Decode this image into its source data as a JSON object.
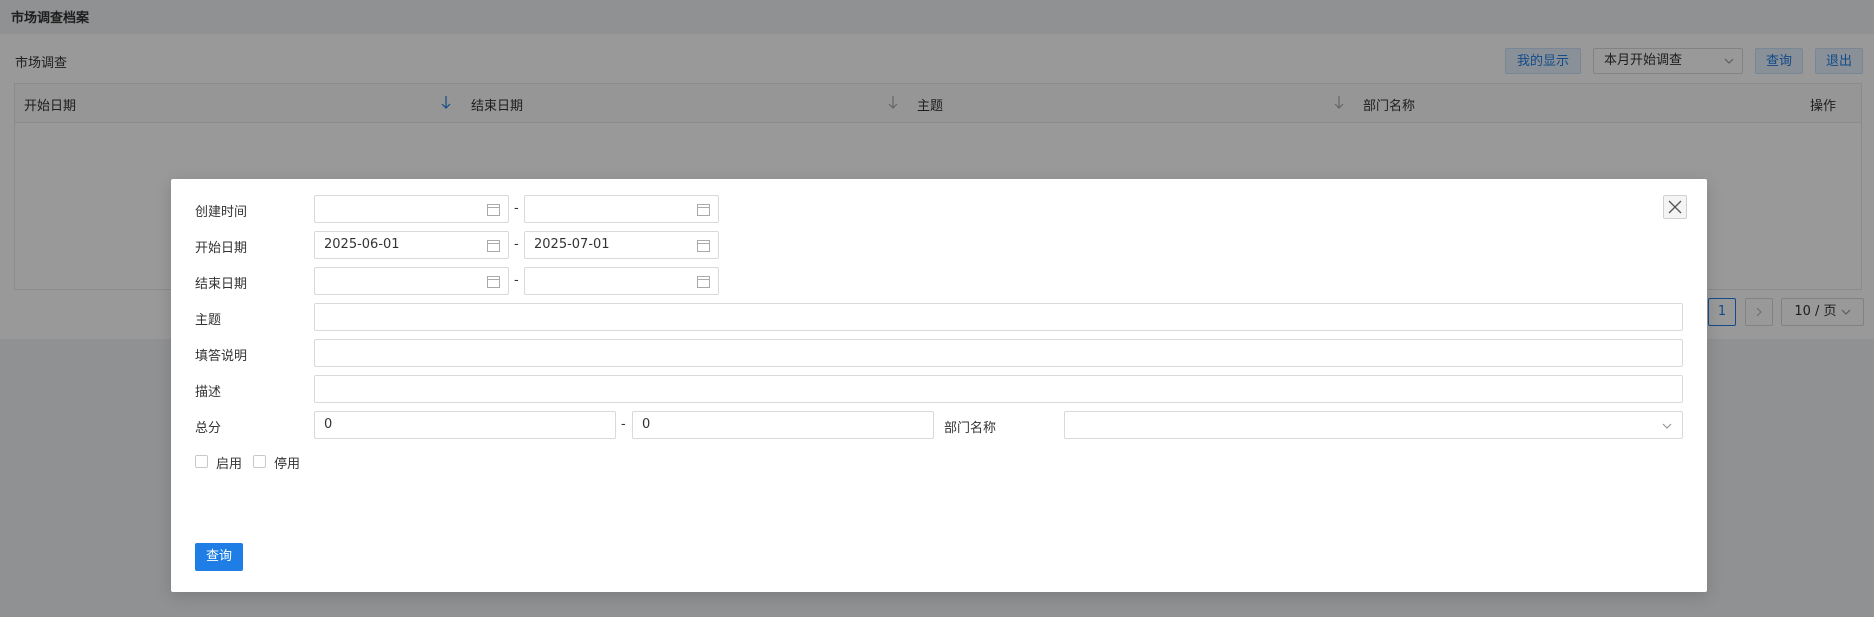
{
  "page": {
    "title": "市场调查档案",
    "panel_title": "市场调查",
    "toolbar": {
      "my_display_label": "我的显示",
      "filter_select_value": "本月开始调查",
      "query_label": "查询",
      "exit_label": "退出"
    },
    "table": {
      "columns": [
        "开始日期",
        "结束日期",
        "主题",
        "部门名称",
        "操作"
      ]
    },
    "pagination": {
      "current_page": "1",
      "page_size": "10 / 页"
    }
  },
  "modal": {
    "fields": {
      "created_time": {
        "label": "创建时间",
        "from": "",
        "to": ""
      },
      "start_date": {
        "label": "开始日期",
        "from": "2025-06-01",
        "to": "2025-07-01"
      },
      "end_date": {
        "label": "结束日期",
        "from": "",
        "to": ""
      },
      "subject": {
        "label": "主题",
        "value": ""
      },
      "fill_instructions": {
        "label": "填答说明",
        "value": ""
      },
      "description": {
        "label": "描述",
        "value": ""
      },
      "total_score": {
        "label": "总分",
        "from": "0",
        "to": "0"
      },
      "department": {
        "label": "部门名称",
        "value": ""
      }
    },
    "range_separator": "-",
    "checkboxes": {
      "enabled_label": "启用",
      "disabled_label": "停用"
    },
    "submit_label": "查询"
  },
  "colors": {
    "primary": "#1e7ee6",
    "overlay": "rgba(0,0,0,0.4)"
  }
}
